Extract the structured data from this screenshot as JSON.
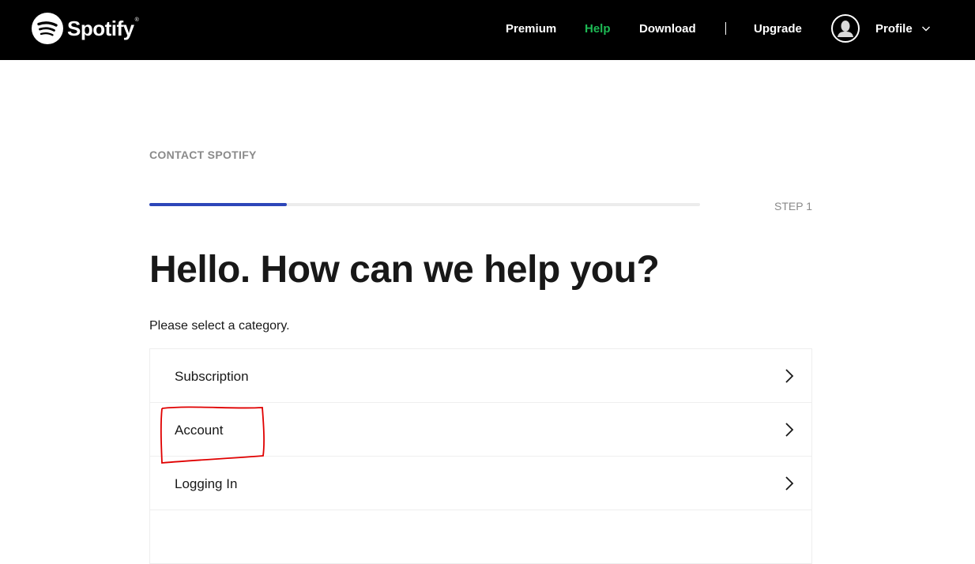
{
  "header": {
    "brand": "Spotify",
    "brand_mark": "®",
    "nav": [
      {
        "label": "Premium",
        "active": false
      },
      {
        "label": "Help",
        "active": true
      },
      {
        "label": "Download",
        "active": false
      },
      {
        "label": "Upgrade",
        "active": false
      }
    ],
    "profile_label": "Profile",
    "icons": {
      "logo": "spotify-logo-icon",
      "avatar": "user-avatar-icon",
      "dropdown": "chevron-down-icon"
    },
    "colors": {
      "background": "#000000",
      "active_link": "#1db954",
      "text": "#ffffff"
    }
  },
  "main": {
    "eyebrow": "CONTACT SPOTIFY",
    "progress": {
      "fraction": 0.25,
      "color": "#2d46b9"
    },
    "step_label": "STEP 1",
    "headline": "Hello. How can we help you?",
    "subtitle": "Please select a category.",
    "categories": [
      {
        "label": "Subscription",
        "icon": "chevron-right-icon"
      },
      {
        "label": "Account",
        "icon": "chevron-right-icon",
        "annotated": true
      },
      {
        "label": "Logging In",
        "icon": "chevron-right-icon"
      }
    ],
    "annotation_color": "#e00000"
  }
}
